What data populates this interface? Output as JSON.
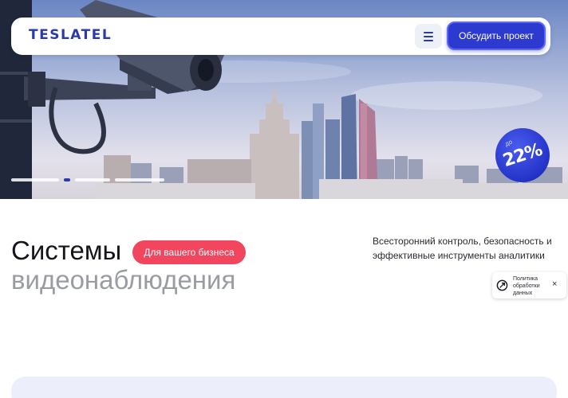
{
  "header": {
    "logo": "TESLATEL",
    "cta_label": "Обсудить проект"
  },
  "hero": {
    "badge_text": "22%",
    "badge_subtext": "до"
  },
  "main": {
    "title_line1": "Системы",
    "title_line2": "видеонаблюдения",
    "tag": "Для вашего бизнеса",
    "description": "Всесторонний контроль, безопасность и эффективные инструменты аналитики"
  },
  "cookie": {
    "text": "Политика обработки данных",
    "close": "×"
  },
  "colors": {
    "brand": "#2b3aa8",
    "cta": "#2d3ad0",
    "tag": "#f2465f"
  },
  "icons": [
    "menu-icon",
    "close-icon",
    "privacy-icon",
    "camera-icon"
  ]
}
